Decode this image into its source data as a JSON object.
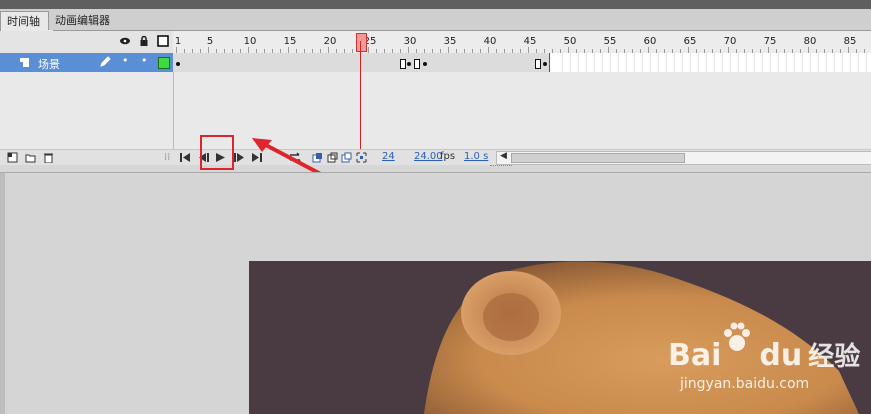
{
  "tabs": [
    {
      "label": "时间轴"
    },
    {
      "label": "动画编辑器"
    }
  ],
  "ruler": {
    "frames": [
      "1",
      "5",
      "10",
      "15",
      "20",
      "25",
      "30",
      "35",
      "40",
      "45",
      "50",
      "55",
      "60",
      "65",
      "70",
      "75",
      "80",
      "85"
    ]
  },
  "layer": {
    "name": "场景"
  },
  "controls": {
    "fps_value": "24.00",
    "fps_unit": "fps",
    "current_frame": "24",
    "time": "1.0 s"
  },
  "watermark": {
    "brand_bai": "Bai",
    "brand_du": "du",
    "brand_jy": "经验",
    "url": "jingyan.baidu.com"
  },
  "colors": {
    "layer_selected": "#5a8ed5",
    "playhead": "#d42020",
    "highlight_box": "#e0242d",
    "layer_color_swatch": "#3ddc3d"
  },
  "icons": [
    "eye-icon",
    "lock-icon",
    "outline-icon",
    "layer-icon",
    "pencil-icon",
    "first-frame-icon",
    "prev-frame-icon",
    "play-icon",
    "next-frame-icon",
    "last-frame-icon",
    "loop-icon",
    "onion-skin-icon",
    "new-layer-icon",
    "new-folder-icon",
    "delete-icon",
    "arrow-annotation"
  ]
}
